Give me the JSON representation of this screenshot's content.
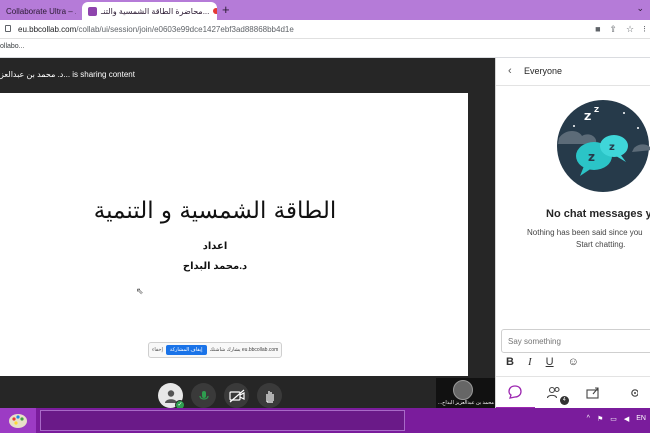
{
  "browser": {
    "tabs": [
      {
        "label": "Collaborate Ultra – ..."
      },
      {
        "label": "محاضرة الطاقة الشمسية والتنـ..."
      }
    ],
    "new_tab": "+",
    "menu_chevron": "⌄",
    "url_domain": "eu.bbcollab.com",
    "url_path": "/collab/ui/session/join/e0603e99dce1427ebf3ad88868bb4d1e",
    "bookmark": "ollabo..."
  },
  "session": {
    "sharing_label": "د. محمد بن عبدالعز... is sharing content",
    "slide": {
      "title": "الطاقة الشمسية و التنمية",
      "subtitle": "اعداد",
      "author": "د.محمد البداح"
    },
    "share_notice": {
      "text": "يشارك شاشتك eu.bbcollab.com",
      "stop_label": "إيقاف المشاركة",
      "hide_label": "إخفاء"
    },
    "participant_name": "...محمد بن عبدالعزيز البداح",
    "accent_color": "#9c27b0",
    "taskbar_color": "#7a1c9c"
  },
  "chat": {
    "header": "Everyone",
    "empty_title": "No chat messages yet",
    "empty_line1": "Nothing has been said since you",
    "empty_line2": "Start chatting.",
    "input_placeholder": "Say something",
    "format": {
      "bold": "B",
      "italic": "I",
      "underline": "U",
      "emoji": "☺"
    },
    "participant_count": "4"
  },
  "taskbar": {
    "tray_lang": "EN"
  }
}
